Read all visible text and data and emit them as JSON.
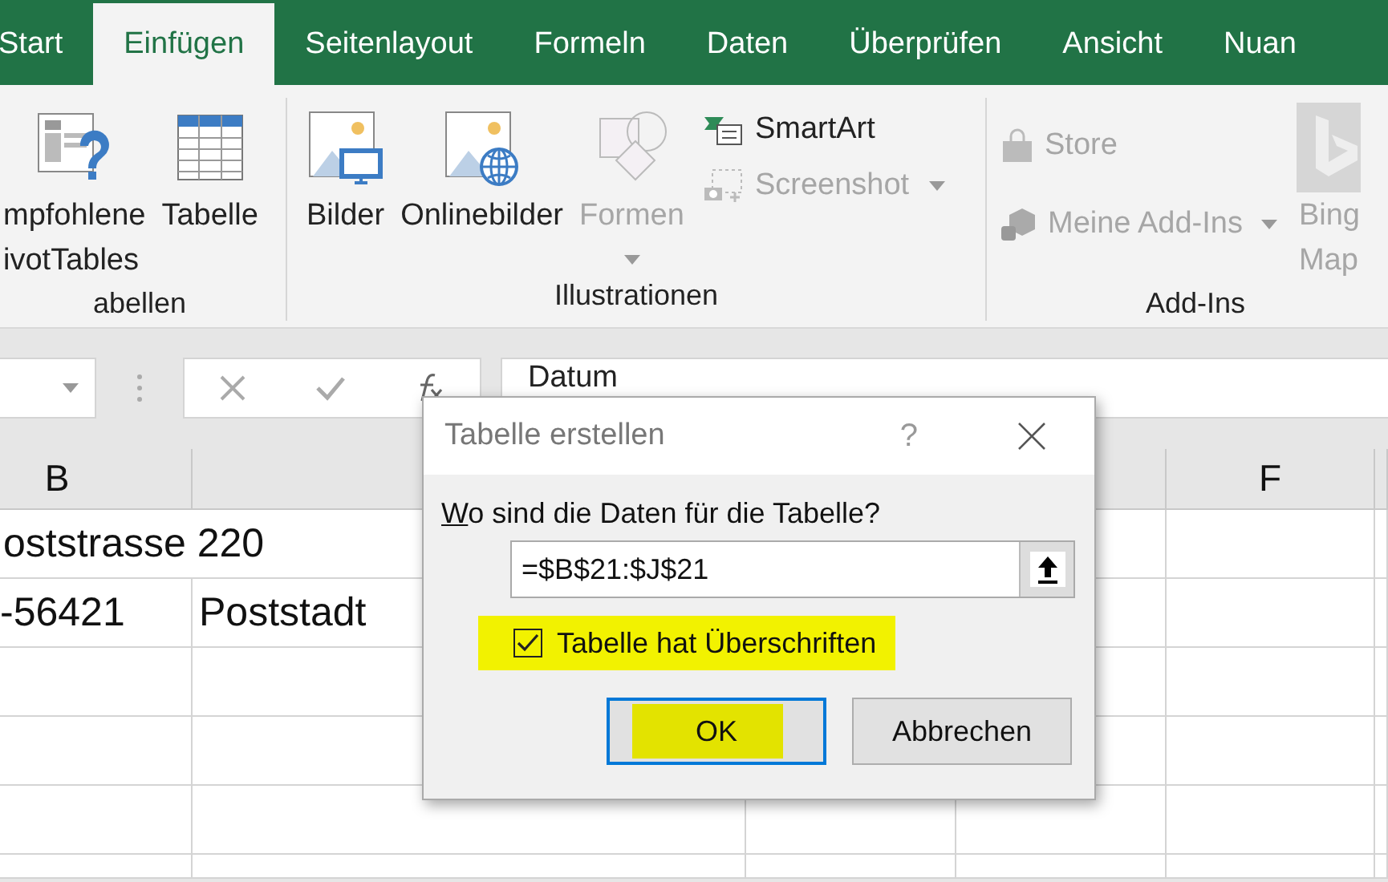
{
  "tabs": [
    {
      "label": "Start",
      "selected": false
    },
    {
      "label": "Einfügen",
      "selected": true
    },
    {
      "label": "Seitenlayout",
      "selected": false
    },
    {
      "label": "Formeln",
      "selected": false
    },
    {
      "label": "Daten",
      "selected": false
    },
    {
      "label": "Überprüfen",
      "selected": false
    },
    {
      "label": "Ansicht",
      "selected": false
    },
    {
      "label": "Nuan",
      "selected": false
    }
  ],
  "ribbon": {
    "groups": [
      {
        "label": "abellen",
        "items": [
          {
            "kind": "large",
            "lines": [
              "mpfohlene",
              "ivotTables"
            ],
            "disabled": false,
            "has_menu": false
          },
          {
            "kind": "large",
            "lines": [
              "Tabelle"
            ],
            "disabled": false,
            "has_menu": false
          }
        ]
      },
      {
        "label": "Illustrationen",
        "items": [
          {
            "kind": "large",
            "lines": [
              "Bilder"
            ],
            "disabled": false,
            "has_menu": false
          },
          {
            "kind": "large",
            "lines": [
              "Onlinebilder"
            ],
            "disabled": false,
            "has_menu": false
          },
          {
            "kind": "large",
            "lines": [
              "Formen"
            ],
            "disabled": true,
            "has_menu": true
          },
          {
            "kind": "stack",
            "items": [
              {
                "label": "SmartArt",
                "disabled": false,
                "has_menu": false
              },
              {
                "label": "Screenshot",
                "disabled": true,
                "has_menu": true
              }
            ]
          }
        ]
      },
      {
        "label": "Add-Ins",
        "items": [
          {
            "kind": "stack",
            "items": [
              {
                "label": "Store",
                "disabled": true,
                "has_menu": false
              },
              {
                "label": "Meine Add-Ins",
                "disabled": true,
                "has_menu": true
              }
            ]
          },
          {
            "kind": "large",
            "lines": [
              "Bing",
              "Map"
            ],
            "disabled": true,
            "has_menu": false
          }
        ]
      }
    ]
  },
  "formula_bar": {
    "formula": "Datum"
  },
  "sheet": {
    "columns": [
      {
        "label": "B"
      },
      {},
      {},
      {},
      {
        "label": "F"
      },
      {}
    ],
    "rows": [
      {
        "cells": [
          "oststrasse 220"
        ]
      },
      {
        "cells": [
          "-56421",
          "Poststadt"
        ]
      },
      {},
      {},
      {},
      {}
    ]
  },
  "dialog": {
    "title": "Tabelle erstellen",
    "help": "?",
    "prompt": "Wo sind die Daten für die Tabelle?",
    "range": "=$B$21:$J$21",
    "checkbox": {
      "label": "Tabelle hat Überschriften",
      "checked": true,
      "highlighted": true
    },
    "buttons": [
      {
        "label": "OK",
        "default": true,
        "highlighted": true
      },
      {
        "label": "Abbrechen",
        "default": false,
        "highlighted": false
      }
    ]
  }
}
